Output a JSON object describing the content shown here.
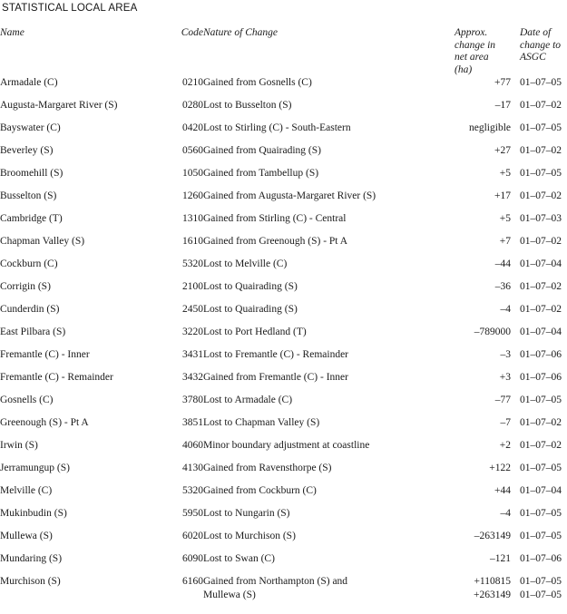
{
  "title": "STATISTICAL LOCAL AREA",
  "columns": {
    "name": "Name",
    "code": "Code",
    "nature": "Nature of Change",
    "area_lines": [
      "Approx.",
      "change in",
      "net area",
      "(ha)"
    ],
    "date_lines": [
      "Date of",
      "change to",
      "ASGC"
    ]
  },
  "rows": [
    {
      "name": "Armadale (C)",
      "code": "0210",
      "nature": [
        "Gained from Gosnells (C)"
      ],
      "area": [
        "+77"
      ],
      "date": [
        "01–07–05"
      ]
    },
    {
      "name": "Augusta-Margaret River (S)",
      "code": "0280",
      "nature": [
        "Lost to Busselton (S)"
      ],
      "area": [
        "–17"
      ],
      "date": [
        "01–07–02"
      ]
    },
    {
      "name": "Bayswater (C)",
      "code": "0420",
      "nature": [
        "Lost to Stirling (C) - South-Eastern"
      ],
      "area": [
        "negligible"
      ],
      "date": [
        "01–07–05"
      ]
    },
    {
      "name": "Beverley (S)",
      "code": "0560",
      "nature": [
        "Gained from Quairading (S)"
      ],
      "area": [
        "+27"
      ],
      "date": [
        "01–07–02"
      ]
    },
    {
      "name": "Broomehill (S)",
      "code": "1050",
      "nature": [
        "Gained from Tambellup (S)"
      ],
      "area": [
        "+5"
      ],
      "date": [
        "01–07–05"
      ]
    },
    {
      "name": "Busselton (S)",
      "code": "1260",
      "nature": [
        "Gained from Augusta-Margaret River (S)"
      ],
      "area": [
        "+17"
      ],
      "date": [
        "01–07–02"
      ]
    },
    {
      "name": "Cambridge (T)",
      "code": "1310",
      "nature": [
        "Gained from Stirling (C) - Central"
      ],
      "area": [
        "+5"
      ],
      "date": [
        "01–07–03"
      ]
    },
    {
      "name": "Chapman Valley (S)",
      "code": "1610",
      "nature": [
        "Gained from Greenough (S) - Pt A"
      ],
      "area": [
        "+7"
      ],
      "date": [
        "01–07–02"
      ]
    },
    {
      "name": "Cockburn (C)",
      "code": "5320",
      "nature": [
        "Lost to Melville (C)"
      ],
      "area": [
        "–44"
      ],
      "date": [
        "01–07–04"
      ]
    },
    {
      "name": "Corrigin (S)",
      "code": "2100",
      "nature": [
        "Lost to Quairading (S)"
      ],
      "area": [
        "–36"
      ],
      "date": [
        "01–07–02"
      ]
    },
    {
      "name": "Cunderdin (S)",
      "code": "2450",
      "nature": [
        "Lost to Quairading (S)"
      ],
      "area": [
        "–4"
      ],
      "date": [
        "01–07–02"
      ]
    },
    {
      "name": "East Pilbara (S)",
      "code": "3220",
      "nature": [
        "Lost to Port Hedland (T)"
      ],
      "area": [
        "–789000"
      ],
      "date": [
        "01–07–04"
      ]
    },
    {
      "name": "Fremantle (C) - Inner",
      "code": "3431",
      "nature": [
        "Lost to Fremantle (C) - Remainder"
      ],
      "area": [
        "–3"
      ],
      "date": [
        "01–07–06"
      ]
    },
    {
      "name": "Fremantle (C) - Remainder",
      "code": "3432",
      "nature": [
        "Gained from Fremantle (C) - Inner"
      ],
      "area": [
        "+3"
      ],
      "date": [
        "01–07–06"
      ]
    },
    {
      "name": "Gosnells (C)",
      "code": "3780",
      "nature": [
        "Lost to Armadale (C)"
      ],
      "area": [
        "–77"
      ],
      "date": [
        "01–07–05"
      ]
    },
    {
      "name": "Greenough (S) - Pt A",
      "code": "3851",
      "nature": [
        "Lost to Chapman Valley (S)"
      ],
      "area": [
        "–7"
      ],
      "date": [
        "01–07–02"
      ]
    },
    {
      "name": "Irwin (S)",
      "code": "4060",
      "nature": [
        "Minor boundary adjustment at coastline"
      ],
      "area": [
        "+2"
      ],
      "date": [
        "01–07–02"
      ]
    },
    {
      "name": "Jerramungup (S)",
      "code": "4130",
      "nature": [
        "Gained from Ravensthorpe (S)"
      ],
      "area": [
        "+122"
      ],
      "date": [
        "01–07–05"
      ]
    },
    {
      "name": "Melville (C)",
      "code": "5320",
      "nature": [
        "Gained from Cockburn (C)"
      ],
      "area": [
        "+44"
      ],
      "date": [
        "01–07–04"
      ]
    },
    {
      "name": "Mukinbudin (S)",
      "code": "5950",
      "nature": [
        "Lost to Nungarin (S)"
      ],
      "area": [
        "–4"
      ],
      "date": [
        "01–07–05"
      ]
    },
    {
      "name": "Mullewa (S)",
      "code": "6020",
      "nature": [
        "Lost to Murchison (S)"
      ],
      "area": [
        "–263149"
      ],
      "date": [
        "01–07–05"
      ]
    },
    {
      "name": "Mundaring (S)",
      "code": "6090",
      "nature": [
        "Lost to Swan (C)"
      ],
      "area": [
        "–121"
      ],
      "date": [
        "01–07–06"
      ]
    },
    {
      "name": "Murchison (S)",
      "code": "6160",
      "nature": [
        "Gained from Northampton (S) and",
        "Mullewa (S)"
      ],
      "area": [
        "+110815",
        "+263149"
      ],
      "date": [
        "01–07–05",
        "01–07–05"
      ]
    }
  ]
}
